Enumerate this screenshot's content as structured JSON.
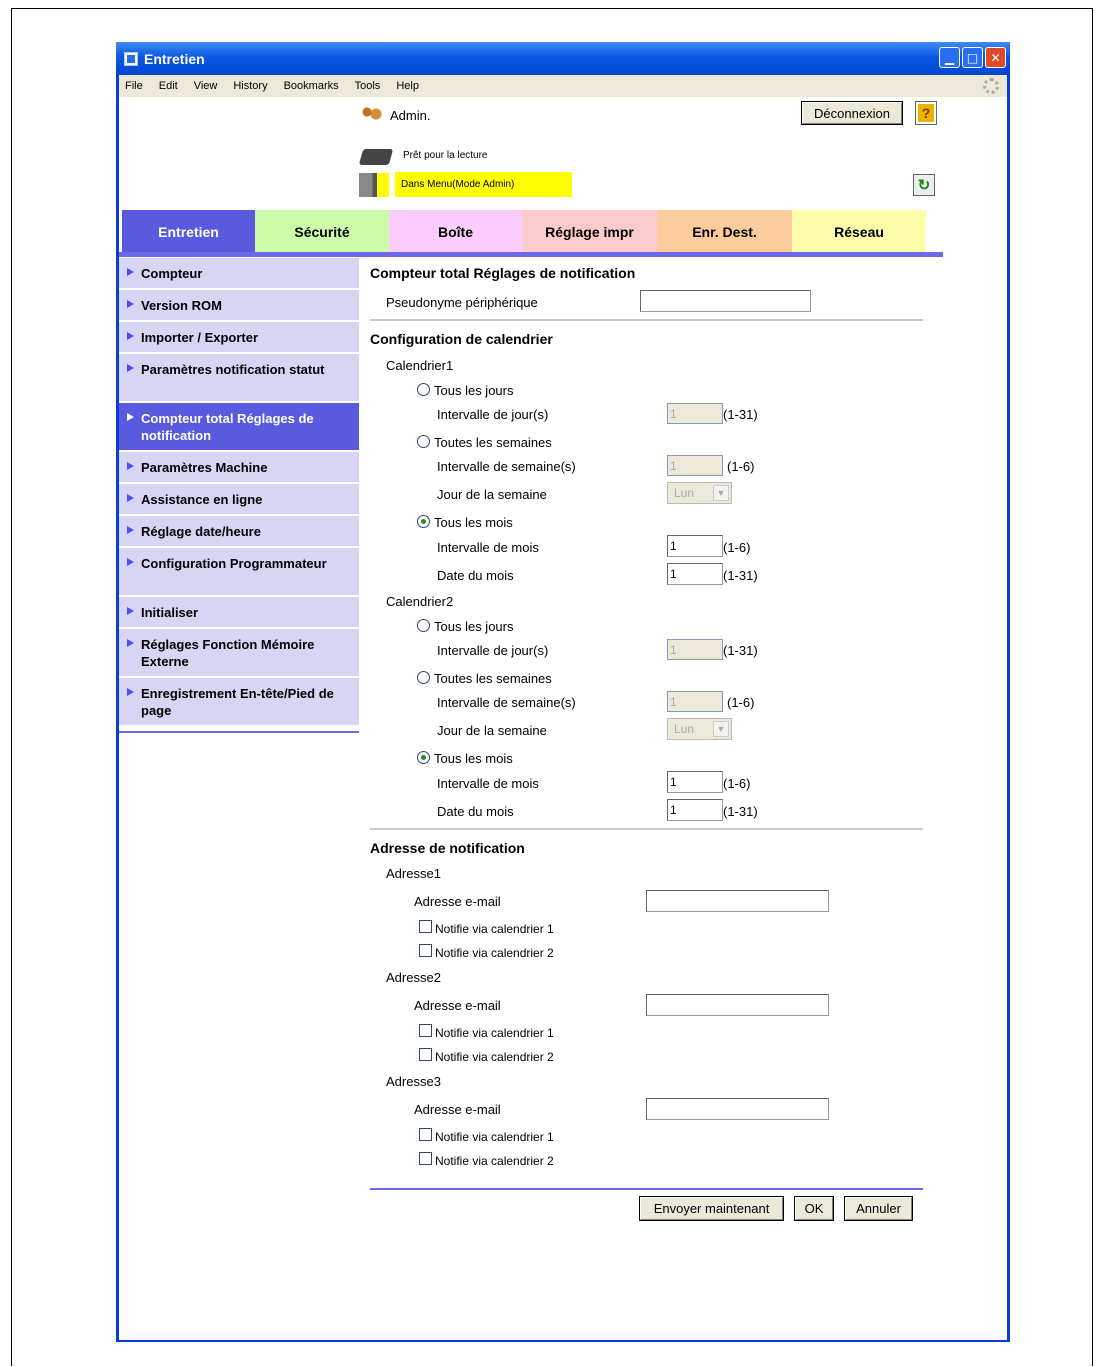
{
  "window": {
    "title": "Entretien"
  },
  "menu": [
    "File",
    "Edit",
    "View",
    "History",
    "Bookmarks",
    "Tools",
    "Help"
  ],
  "header": {
    "user": "Admin.",
    "logout": "Déconnexion",
    "help": "?",
    "status1": "Prêt pour la lecture",
    "status2": "Dans Menu(Mode Admin)"
  },
  "tabs": [
    {
      "label": "Entretien",
      "color": "#5a5ade",
      "text": "#ffffff"
    },
    {
      "label": "Sécurité",
      "color": "#ccfcaa",
      "text": "#000000"
    },
    {
      "label": "Boîte",
      "color": "#fcccfc",
      "text": "#000000"
    },
    {
      "label": "Réglage impr",
      "color": "#fccccc",
      "text": "#000000"
    },
    {
      "label": "Enr. Dest.",
      "color": "#fccc9c",
      "text": "#000000"
    },
    {
      "label": "Réseau",
      "color": "#fcfcaa",
      "text": "#000000"
    }
  ],
  "sidebar": [
    "Compteur",
    "Version ROM",
    "Importer / Exporter",
    "Paramètres notification statut",
    "Compteur total Réglages de notification",
    "Paramètres Machine",
    "Assistance en ligne",
    "Réglage date/heure",
    "Configuration Programmateur",
    "Initialiser",
    "Réglages Fonction Mémoire Externe",
    "Enregistrement En-tête/Pied de page"
  ],
  "main": {
    "title": "Compteur total Réglages de notification",
    "alias_label": "Pseudonyme périphérique",
    "alias_value": "",
    "calendar_title": "Configuration de calendrier",
    "calendars": [
      {
        "name": "Calendrier1",
        "daily": "Tous les jours",
        "day_interval": "Intervalle de jour(s)",
        "day_val": "1",
        "day_range": "(1-31)",
        "weekly": "Toutes les semaines",
        "week_interval": "Intervalle de semaine(s)",
        "week_val": "1",
        "week_range": "(1-6)",
        "weekday": "Jour de la semaine",
        "weekday_val": "Lun",
        "monthly": "Tous les mois",
        "month_interval": "Intervalle de mois",
        "month_val": "1",
        "month_range": "(1-6)",
        "date": "Date du mois",
        "date_val": "1",
        "date_range": "(1-31)"
      },
      {
        "name": "Calendrier2",
        "daily": "Tous les jours",
        "day_interval": "Intervalle de jour(s)",
        "day_val": "1",
        "day_range": "(1-31)",
        "weekly": "Toutes les semaines",
        "week_interval": "Intervalle de semaine(s)",
        "week_val": "1",
        "week_range": "(1-6)",
        "weekday": "Jour de la semaine",
        "weekday_val": "Lun",
        "monthly": "Tous les mois",
        "month_interval": "Intervalle de mois",
        "month_val": "1",
        "month_range": "(1-6)",
        "date": "Date du mois",
        "date_val": "1",
        "date_range": "(1-31)"
      }
    ],
    "address_title": "Adresse de notification",
    "addresses": [
      {
        "name": "Adresse1",
        "email_label": "Adresse e-mail",
        "email": "",
        "cal1": "Notifie via calendrier 1",
        "cal2": "Notifie via calendrier 2"
      },
      {
        "name": "Adresse2",
        "email_label": "Adresse e-mail",
        "email": "",
        "cal1": "Notifie via calendrier 1",
        "cal2": "Notifie via calendrier 2"
      },
      {
        "name": "Adresse3",
        "email_label": "Adresse e-mail",
        "email": "",
        "cal1": "Notifie via calendrier 1",
        "cal2": "Notifie via calendrier 2"
      }
    ],
    "buttons": {
      "send": "Envoyer maintenant",
      "ok": "OK",
      "cancel": "Annuler"
    }
  }
}
